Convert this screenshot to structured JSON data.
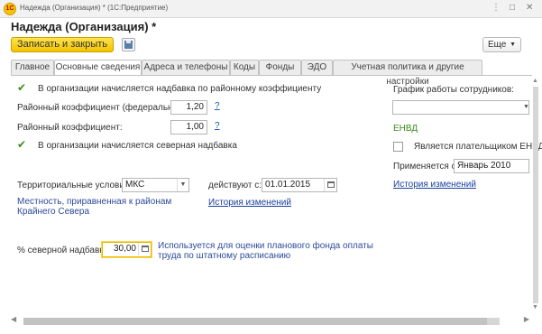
{
  "window": {
    "title": "Надежда (Организация) * (1С:Предприятие)",
    "app_icon": "1С"
  },
  "form": {
    "title": "Надежда (Организация) *"
  },
  "toolbar": {
    "save_close_label": "Записать и закрыть",
    "more_label": "Еще"
  },
  "tabs": [
    {
      "label": "Главное"
    },
    {
      "label": "Основные сведения"
    },
    {
      "label": "Адреса и телефоны"
    },
    {
      "label": "Коды"
    },
    {
      "label": "Фонды"
    },
    {
      "label": "ЭДО"
    },
    {
      "label": "Учетная политика и другие настройки"
    }
  ],
  "regional": {
    "checkbox_label": "В организации начисляется надбавка по районному коэффициенту",
    "federal_label": "Районный коэффициент (федеральный):",
    "federal_value": "1,20",
    "coef_label": "Районный коэффициент:",
    "coef_value": "1,00",
    "help": "?"
  },
  "north": {
    "checkbox_label": "В организации начисляется северная надбавка",
    "territory_label": "Территориальные условия:",
    "territory_value": "МКС",
    "valid_from_label": "действуют с:",
    "valid_from_value": "01.01.2015",
    "territory_note": "Местность, приравненная к районам Крайнего Севера",
    "history_link": "История изменений",
    "percent_label": "% северной надбавки:",
    "percent_value": "30,00",
    "percent_note": "Используется для оценки планового фонда оплаты труда по штатному расписанию"
  },
  "right_panel": {
    "schedule_label": "График работы сотрудников:",
    "schedule_value": "",
    "envd_title": "ЕНВД",
    "envd_checkbox_label": "Является плательщиком ЕНВД",
    "applies_label": "Применяется с:",
    "applies_value": "Январь 2010",
    "history_link": "История изменений"
  },
  "colors": {
    "accent_yellow": "#f2c200",
    "check_green": "#3a8a1c",
    "link_blue": "#1a3fa0"
  }
}
